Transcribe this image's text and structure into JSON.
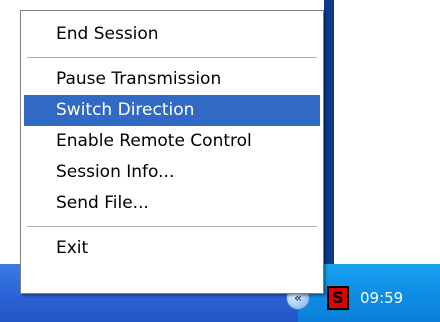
{
  "menu": {
    "items": [
      {
        "label": "End Session"
      },
      {
        "label": "Pause Transmission"
      },
      {
        "label": "Switch Direction",
        "selected": true
      },
      {
        "label": "Enable Remote Control"
      },
      {
        "label": "Session Info..."
      },
      {
        "label": "Send File..."
      },
      {
        "label": "Exit"
      }
    ]
  },
  "taskbar": {
    "clock": "09:59",
    "tray_app_letter": "S",
    "tray_chevron_glyph": "«",
    "colors": {
      "selection": "#316ac5",
      "tray_icon": "#e00000"
    }
  }
}
